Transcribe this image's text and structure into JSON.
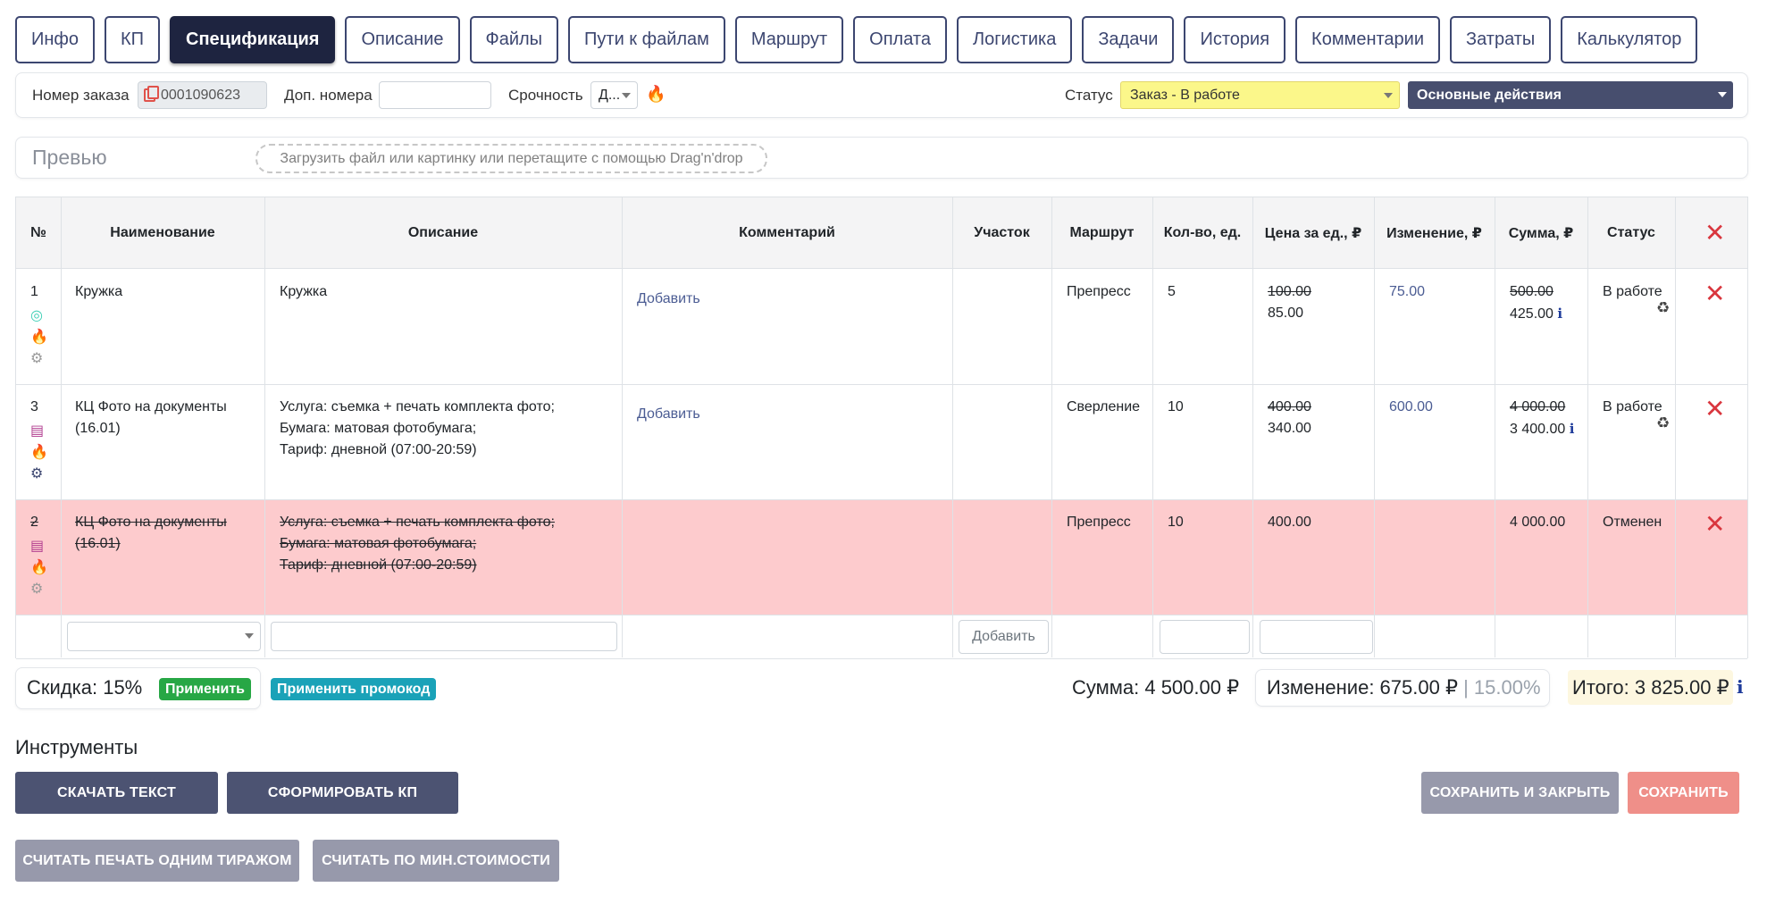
{
  "tabs": [
    "Инфо",
    "КП",
    "Спецификация",
    "Описание",
    "Файлы",
    "Пути к файлам",
    "Маршрут",
    "Оплата",
    "Логистика",
    "Задачи",
    "История",
    "Комментарии",
    "Затраты",
    "Калькулятор"
  ],
  "active_tab": "Спецификация",
  "header": {
    "order_label": "Номер заказа",
    "order_number": "0001090623",
    "extra_numbers_label": "Доп. номера",
    "extra_numbers_value": "",
    "urgency_label": "Срочность",
    "urgency_value": "Д...",
    "status_label": "Статус",
    "status_value": "Заказ - В работе",
    "actions_label": "Основные действия"
  },
  "preview": {
    "label": "Превью",
    "dropzone_text": "Загрузить файл или картинку или перетащите с помощью Drag'n'drop"
  },
  "table": {
    "columns": [
      "№",
      "Наименование",
      "Описание",
      "Комментарий",
      "Участок",
      "Маршрут",
      "Кол-во, ед.",
      "Цена за ед., ₽",
      "Изменение, ₽",
      "Сумма, ₽",
      "Статус"
    ],
    "rows": [
      {
        "num": "1",
        "name": "Кружка",
        "description": [
          "Кружка"
        ],
        "comment_link": "Добавить",
        "area": "",
        "route": "Препресс",
        "qty": "5",
        "price_old": "100.00",
        "price_new": "85.00",
        "change": "75.00",
        "sum_old": "500.00",
        "sum_new": "425.00",
        "status": "В работе",
        "cancelled": false
      },
      {
        "num": "3",
        "name": "КЦ Фото на документы (16.01)",
        "description": [
          "Услуга: съемка + печать комплекта фото;",
          "Бумага: матовая фотобумага;",
          "Тариф: дневной (07:00-20:59)"
        ],
        "comment_link": "Добавить",
        "area": "",
        "route": "Сверление",
        "qty": "10",
        "price_old": "400.00",
        "price_new": "340.00",
        "change": "600.00",
        "sum_old": "4 000.00",
        "sum_new": "3 400.00",
        "status": "В работе",
        "cancelled": false
      },
      {
        "num": "2",
        "name": "КЦ Фото на документы (16.01)",
        "description": [
          "Услуга: съемка + печать комплекта фото;",
          "Бумага: матовая фотобумага;",
          "Тариф: дневной (07:00-20:59)"
        ],
        "comment_link": "",
        "area": "",
        "route": "Препресс",
        "qty": "10",
        "price": "400.00",
        "change": "",
        "sum": "4 000.00",
        "status": "Отменен",
        "cancelled": true
      }
    ],
    "new_row": {
      "add_button": "Добавить"
    }
  },
  "summary": {
    "discount_label": "Скидка: 15%",
    "apply_label": "Применить",
    "promo_label": "Применить промокод",
    "sum_label": "Сумма: 4 500.00 ₽",
    "change_label": "Изменение: 675.00 ₽",
    "change_pct": "| 15.00%",
    "total_label": "Итого: 3 825.00 ₽"
  },
  "tools": {
    "title": "Инструменты",
    "download_text": "СКАЧАТЬ ТЕКСТ",
    "make_offer": "СФОРМИРОВАТЬ КП",
    "save_close": "СОХРАНИТЬ И ЗАКРЫТЬ",
    "save": "СОХРАНИТЬ",
    "calc_one_run": "СЧИТАТЬ ПЕЧАТЬ ОДНИМ ТИРАЖОМ",
    "calc_min_cost": "СЧИТАТЬ ПО МИН.СТОИМОСТИ"
  },
  "icons": {
    "copy": "copy-icon",
    "flame": "flame-icon",
    "delete": "close-x-icon",
    "person": "person-circle-icon",
    "gears": "gears-icon",
    "document": "document-icon",
    "recycle": "recycle-icon",
    "info": "info-icon"
  },
  "colors": {
    "primary": "#3c4670",
    "active_tab": "#1e2440",
    "status_yellow": "#fbf78a",
    "cancelled_row": "#fdcbcd",
    "delete_red": "#d9363e",
    "apply_green": "#27a745",
    "promo_teal": "#1aa2b8",
    "save_red": "#ef8f89"
  }
}
